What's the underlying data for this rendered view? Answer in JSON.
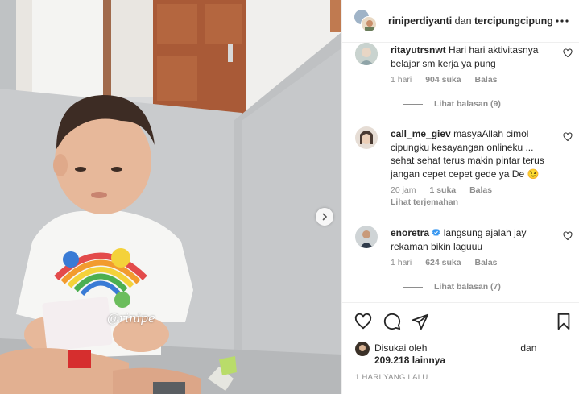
{
  "media": {
    "watermark": "@rinipe"
  },
  "header": {
    "user1": "riniperdiyanti",
    "joiner": "dan",
    "user2": "tercipungcipung"
  },
  "comments": [
    {
      "username": "ritayutrsnwt",
      "text": "Hari hari aktivitasnya belajar sm kerja ya pung",
      "time": "1 hari",
      "likes": "904 suka",
      "reply": "Balas",
      "view_replies": "Lihat balasan (9)"
    },
    {
      "username": "call_me_giev",
      "text": "masyaAllah cimol cipungku kesayangan onlineku ... sehat sehat terus makin pintar terus jangan cepet cepet gede ya De 😉",
      "time": "20 jam",
      "likes": "1 suka",
      "reply": "Balas",
      "translate": "Lihat terjemahan"
    },
    {
      "username": "enoretra",
      "verified": true,
      "text": "langsung ajalah jay rekaman bikin laguuu",
      "time": "1 hari",
      "likes": "624 suka",
      "reply": "Balas",
      "view_replies": "Lihat balasan (7)"
    }
  ],
  "liked_by": {
    "prefix": "Disukai oleh",
    "joiner": "dan",
    "count": "209.218 lainnya"
  },
  "timestamp": "1 HARI YANG LALU",
  "icons": [
    "heart-icon",
    "comment-icon",
    "share-icon",
    "bookmark-icon",
    "more-icon",
    "chevron-right-icon",
    "verified-icon"
  ]
}
